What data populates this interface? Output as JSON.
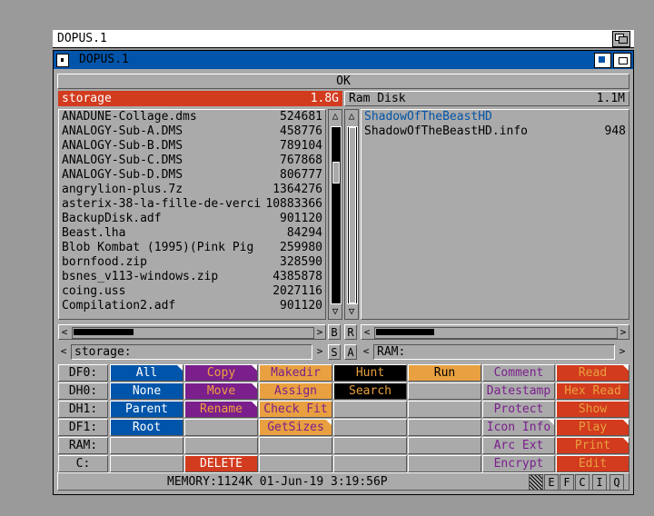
{
  "screen_title": "DOPUS.1",
  "window_title": "DOPUS.1",
  "ok_label": "OK",
  "left_panel": {
    "path_name": "storage",
    "path_size": "1.8G",
    "path_field": "storage:",
    "files": [
      {
        "name": "ANADUNE-Collage.dms",
        "size": "524681"
      },
      {
        "name": "ANALOGY-Sub-A.DMS",
        "size": "458776"
      },
      {
        "name": "ANALOGY-Sub-B.DMS",
        "size": "789104"
      },
      {
        "name": "ANALOGY-Sub-C.DMS",
        "size": "767868"
      },
      {
        "name": "ANALOGY-Sub-D.DMS",
        "size": "806777"
      },
      {
        "name": "angrylion-plus.7z",
        "size": "1364276"
      },
      {
        "name": "asterix-38-la-fille-de-verci",
        "size": "10883366"
      },
      {
        "name": "BackupDisk.adf",
        "size": "901120"
      },
      {
        "name": "Beast.lha",
        "size": "84294"
      },
      {
        "name": "Blob Kombat (1995)(Pink Pig",
        "size": "259980"
      },
      {
        "name": "bornfood.zip",
        "size": "328590"
      },
      {
        "name": "bsnes_v113-windows.zip",
        "size": "4385878"
      },
      {
        "name": "coing.uss",
        "size": "2027116"
      },
      {
        "name": "Compilation2.adf",
        "size": "901120"
      }
    ]
  },
  "right_panel": {
    "path_name": "Ram Disk",
    "path_size": "1.1M",
    "path_field": "RAM:",
    "files": [
      {
        "name": "ShadowOfTheBeastHD",
        "size": "",
        "dir": true
      },
      {
        "name": "ShadowOfTheBeastHD.info",
        "size": "948",
        "dir": false
      }
    ]
  },
  "mid_buttons": {
    "b": "B",
    "r": "R",
    "s": "S",
    "a": "A"
  },
  "drives": [
    "DF0:",
    "DH0:",
    "DH1:",
    "DF1:",
    "RAM:",
    "C:"
  ],
  "buttons": {
    "all": "All",
    "none": "None",
    "parent": "Parent",
    "root": "Root",
    "copy": "Copy",
    "move": "Move",
    "rename": "Rename",
    "delete": "DELETE",
    "makedir": "Makedir",
    "assign": "Assign",
    "checkfit": "Check Fit",
    "getsizes": "GetSizes",
    "hunt": "Hunt",
    "search": "Search",
    "run": "Run",
    "comment": "Comment",
    "datestamp": "Datestamp",
    "protect": "Protect",
    "iconinfo": "Icon Info",
    "arcext": "Arc Ext",
    "encrypt": "Encrypt",
    "read": "Read",
    "hexread": "Hex Read",
    "show": "Show",
    "play": "Play",
    "print": "Print",
    "edit": "Edit"
  },
  "status": {
    "text": "MEMORY:1124K  01-Jun-19   3:19:56P",
    "boxes": [
      "E",
      "F",
      "C",
      "I",
      "Q"
    ]
  },
  "colors": {
    "blue": "#0055aa",
    "red": "#d23b1e",
    "purple": "#7a1f8c",
    "orange": "#e8a040",
    "grey": "#aaaaaa",
    "black": "#000000"
  }
}
